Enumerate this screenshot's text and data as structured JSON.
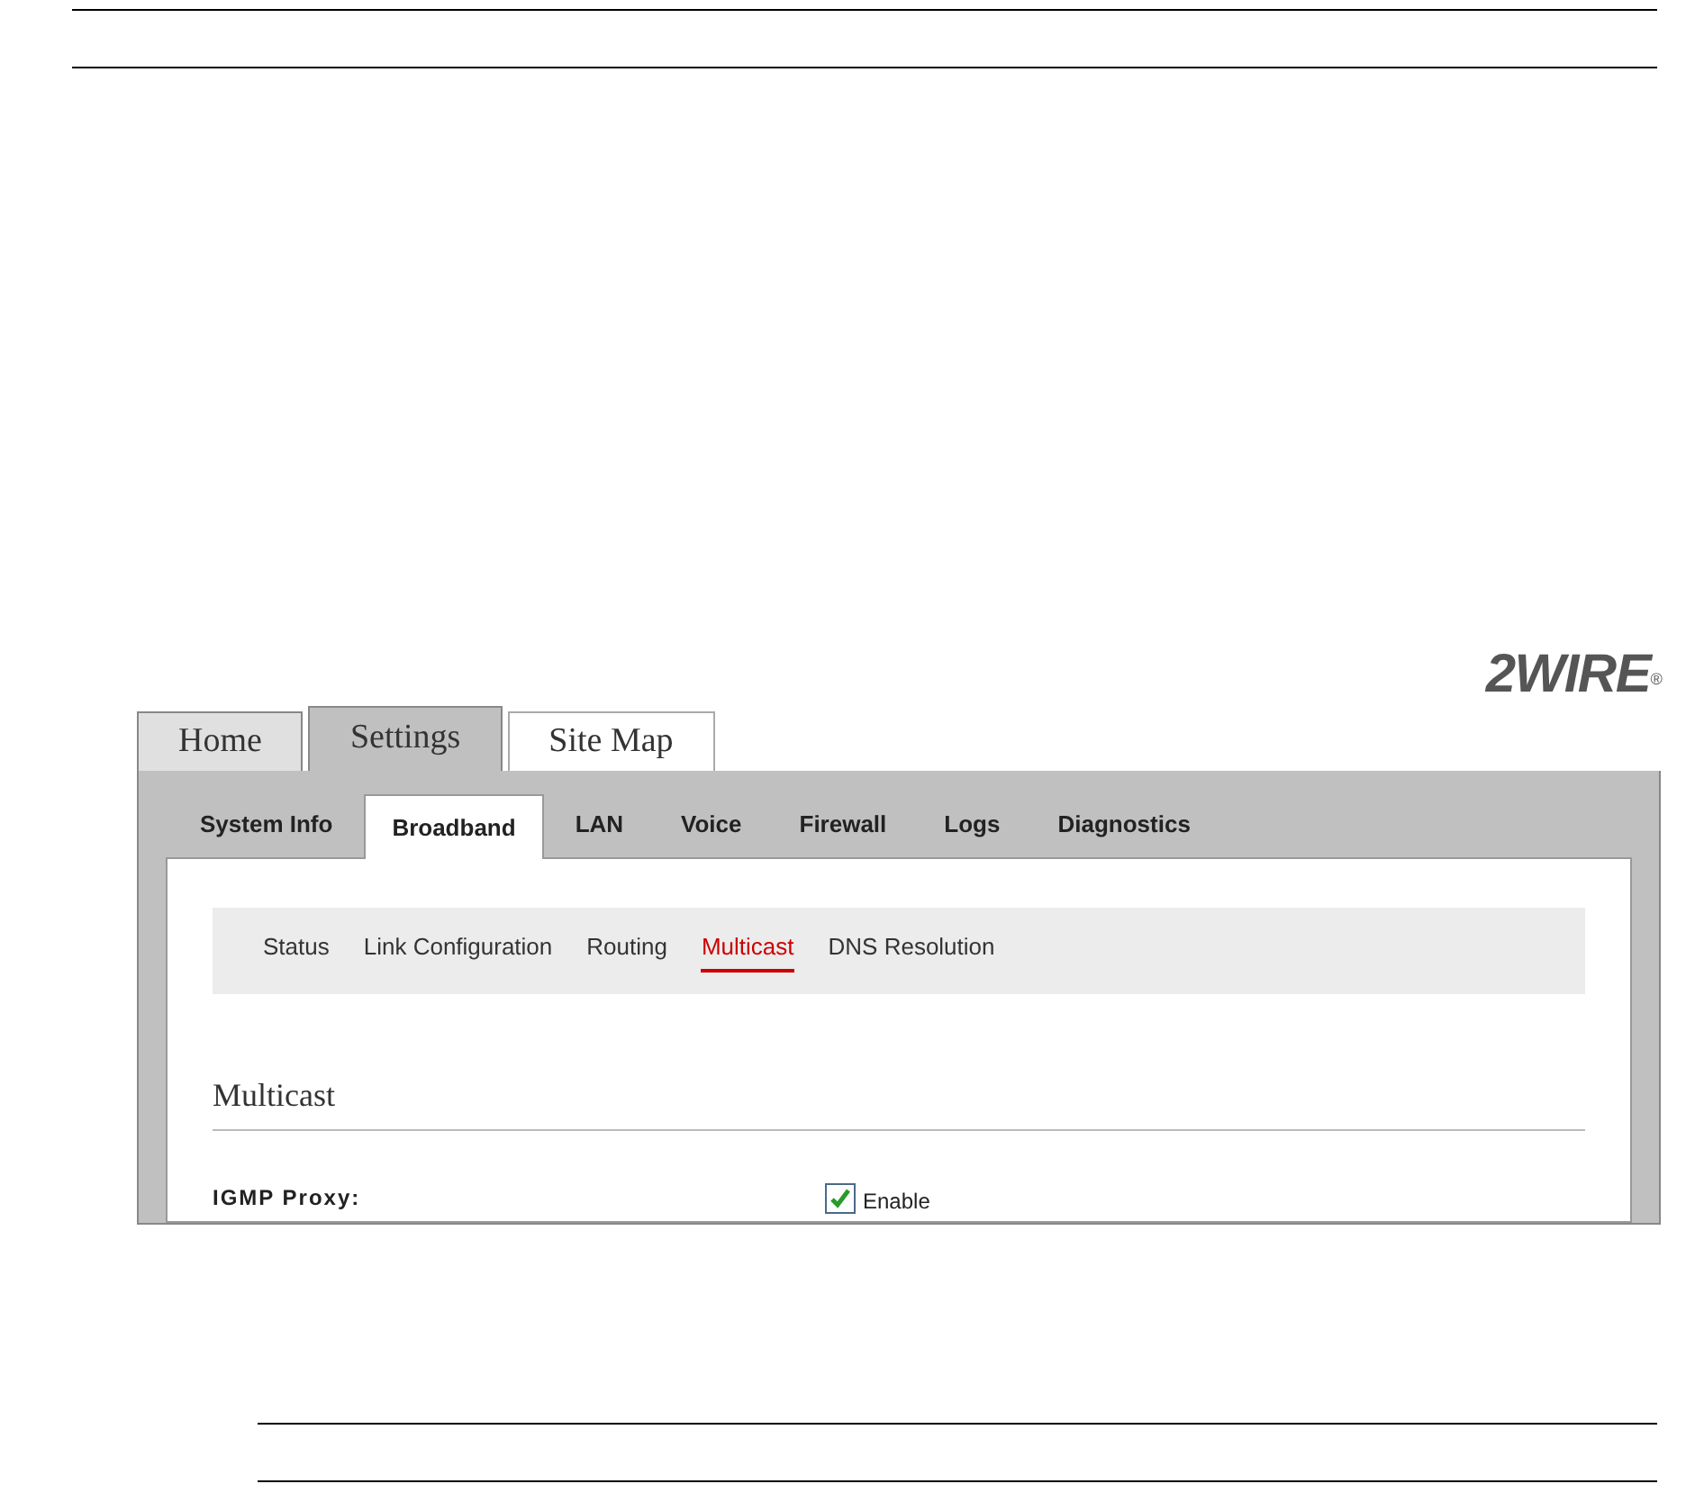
{
  "logo": {
    "text": "2WIRE",
    "mark": "®"
  },
  "tabs": [
    {
      "label": "Home",
      "selected": false,
      "kind": "shaded"
    },
    {
      "label": "Settings",
      "selected": true,
      "kind": "shaded"
    },
    {
      "label": "Site Map",
      "selected": false,
      "kind": "plain"
    }
  ],
  "subtabs": [
    {
      "label": "System Info",
      "selected": false
    },
    {
      "label": "Broadband",
      "selected": true
    },
    {
      "label": "LAN",
      "selected": false
    },
    {
      "label": "Voice",
      "selected": false
    },
    {
      "label": "Firewall",
      "selected": false
    },
    {
      "label": "Logs",
      "selected": false
    },
    {
      "label": "Diagnostics",
      "selected": false
    }
  ],
  "nav": [
    {
      "label": "Status",
      "selected": false
    },
    {
      "label": "Link Configuration",
      "selected": false
    },
    {
      "label": "Routing",
      "selected": false
    },
    {
      "label": "Multicast",
      "selected": true
    },
    {
      "label": "DNS Resolution",
      "selected": false
    }
  ],
  "section": {
    "title": "Multicast",
    "fields": [
      {
        "label": "IGMP Proxy:",
        "checked": true,
        "option": "Enable"
      }
    ]
  }
}
